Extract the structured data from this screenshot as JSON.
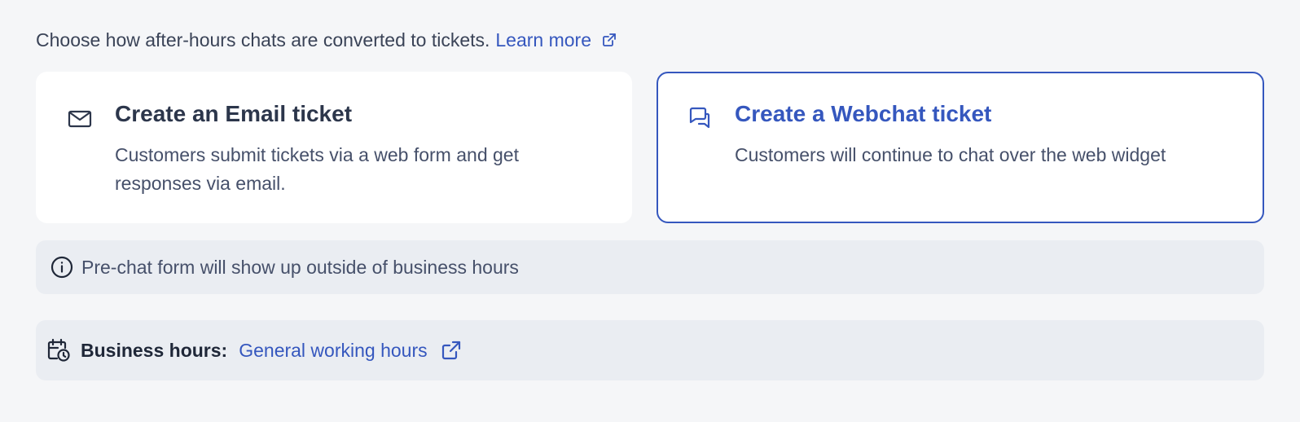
{
  "intro": {
    "text": "Choose how after-hours chats are converted to tickets.",
    "learn_more": "Learn more",
    "external_icon": "external-link-icon"
  },
  "options": [
    {
      "title": "Create an Email ticket",
      "description": "Customers submit tickets via a web form and get responses via email.",
      "icon": "mail-icon",
      "selected": false
    },
    {
      "title": "Create a Webchat ticket",
      "description": "Customers will continue to chat over the web widget",
      "icon": "chat-bubbles-icon",
      "selected": true
    }
  ],
  "notice": {
    "icon": "info-icon",
    "text": "Pre-chat form will show up outside of business hours"
  },
  "business_hours": {
    "icon": "calendar-clock-icon",
    "label": "Business hours:",
    "value": "General working hours",
    "external_icon": "external-link-icon"
  },
  "colors": {
    "accent": "#3557be",
    "background": "#f5f6f8",
    "card": "#ffffff",
    "panel": "#eaedf2"
  }
}
